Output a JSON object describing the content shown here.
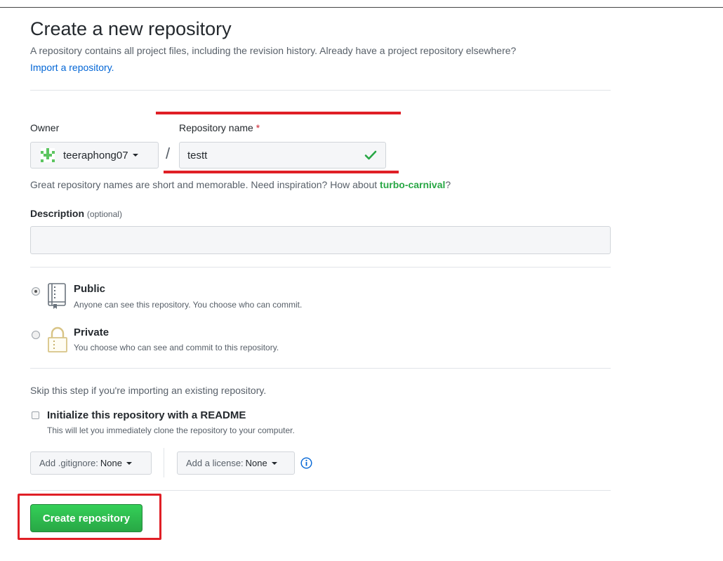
{
  "header": {
    "title": "Create a new repository",
    "subtitle": "A repository contains all project files, including the revision history. Already have a project repository elsewhere?",
    "import_link": "Import a repository."
  },
  "owner": {
    "label": "Owner",
    "value": "teeraphong07",
    "avatar_icon": "identicon-icon"
  },
  "separator": "/",
  "repo_name": {
    "label": "Repository name",
    "required_mark": "*",
    "value": "testt",
    "status_icon": "check-icon"
  },
  "hint": {
    "text": "Great repository names are short and memorable. Need inspiration? How about ",
    "suggestion": "turbo-carnival",
    "end": "?"
  },
  "description": {
    "label": "Description",
    "optional": "(optional)",
    "value": ""
  },
  "visibility": {
    "public": {
      "label": "Public",
      "desc": "Anyone can see this repository. You choose who can commit.",
      "selected": true,
      "icon": "repo-icon"
    },
    "private": {
      "label": "Private",
      "desc": "You choose who can see and commit to this repository.",
      "selected": false,
      "icon": "lock-icon"
    }
  },
  "init": {
    "skip_text": "Skip this step if you're importing an existing repository.",
    "readme_label": "Initialize this repository with a README",
    "readme_note": "This will let you immediately clone the repository to your computer.",
    "readme_checked": false
  },
  "gitignore": {
    "prefix": "Add .gitignore:",
    "value": "None"
  },
  "license": {
    "prefix": "Add a license:",
    "value": "None"
  },
  "submit": {
    "label": "Create repository"
  },
  "colors": {
    "accent_link": "#0366d6",
    "success": "#28a745",
    "annotation": "#e01f26"
  }
}
